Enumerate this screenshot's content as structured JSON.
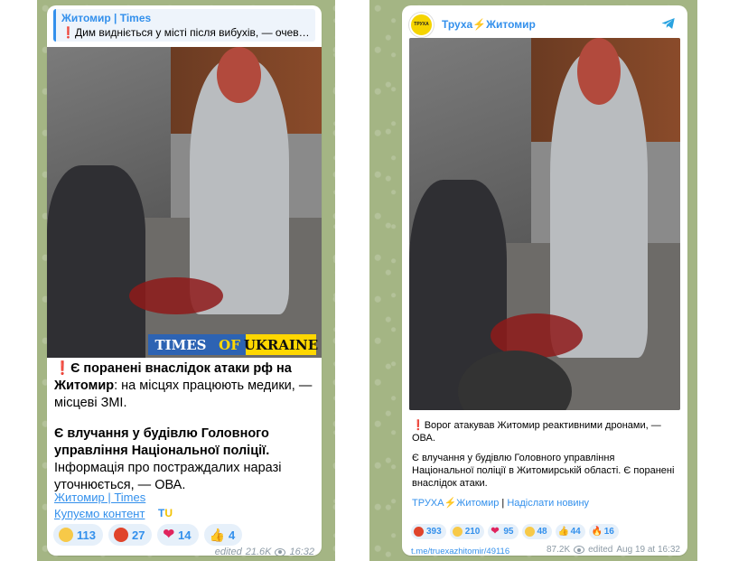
{
  "post1": {
    "reply": {
      "title": "Житомир | Times",
      "excerpt": "❗Дим видніється у місті після вибухів, — очевидці"
    },
    "banner": {
      "part1": "TIMES",
      "part2": "OF",
      "part3": "UKRAINE"
    },
    "text": {
      "excl": "❗",
      "line1_bold": "Є поранені внаслідок атаки рф на Житомир",
      "line1_rest": ": на місцях працюють медики, — місцеві ЗМІ.",
      "line2_bold": "Є влучання у будівлю Головного управління Національної поліції.",
      "line2_rest": " Інформація про постраждалих наразі уточнюється, — ОВА."
    },
    "sig1": "Житомир | Times",
    "sig2": "Купуємо контент",
    "tu": {
      "t": "T",
      "u": "U"
    },
    "reactions": [
      {
        "icon": "crying-face-icon",
        "count": "113",
        "color": "#f7c948"
      },
      {
        "icon": "angry-face-icon",
        "count": "27",
        "color": "#e0442b"
      },
      {
        "icon": "heart-icon",
        "count": "14"
      },
      {
        "icon": "thumbs-up-icon",
        "count": "4"
      }
    ],
    "meta": {
      "edited": "edited",
      "views": "21.6K",
      "time": "16:32"
    }
  },
  "post2": {
    "channel": "Труха⚡Житомир",
    "logo_text": "ТРУХА",
    "text": {
      "excl": "❗",
      "p1": "Ворог атакував Житомир реактивними дронами, — ОВА.",
      "p2": "Є влучання у будівлю Головного управління Національної поліції в Житомирській області. Є поранені внаслідок атаки."
    },
    "sig_channel": "ТРУХА⚡Житомир",
    "sig_sep": " | ",
    "sig_news": "Надіслати новину",
    "reactions": [
      {
        "icon": "angry-face-icon",
        "count": "393",
        "color": "#e0442b"
      },
      {
        "icon": "sad-face-icon",
        "count": "210",
        "color": "#f7c948"
      },
      {
        "icon": "heart-icon",
        "count": "95"
      },
      {
        "icon": "crying-face-icon",
        "count": "48",
        "color": "#f7c948"
      },
      {
        "icon": "thumbs-up-icon",
        "count": "44"
      },
      {
        "icon": "fire-icon",
        "count": "16"
      }
    ],
    "permalink": "t.me/truexazhitomir/49116",
    "meta": {
      "views": "87.2K",
      "edited": "edited",
      "date": "Aug 19 at 16:32"
    }
  }
}
